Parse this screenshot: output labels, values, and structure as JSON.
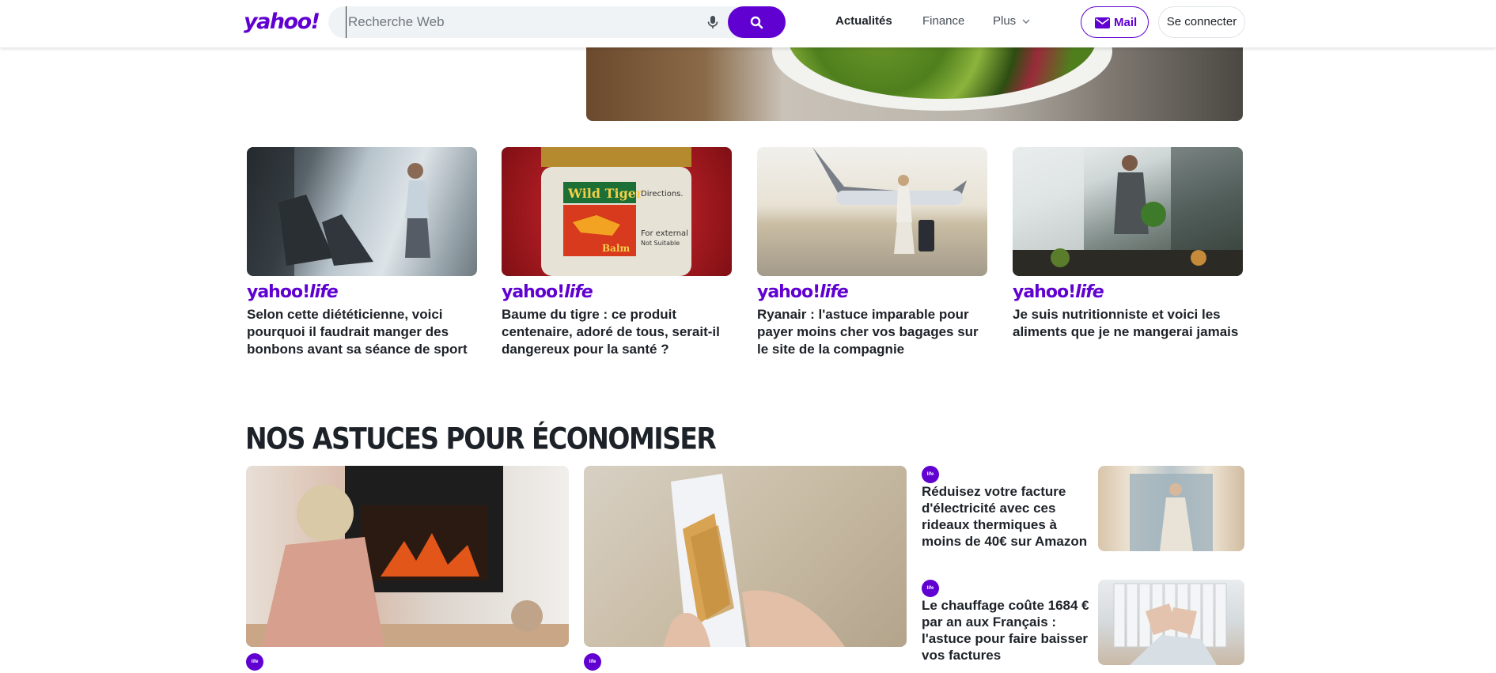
{
  "header": {
    "logo": "yahoo!",
    "search_placeholder": "Recherche Web",
    "nav": [
      "Actualités",
      "Finance",
      "Plus"
    ],
    "mail_label": "Mail",
    "signin_label": "Se connecter"
  },
  "cards": [
    {
      "brand": "yahoo!",
      "brand_suffix": "life",
      "title": "Selon cette diététicienne, voici pourquoi il faudrait manger des bonbons avant sa séance de sport"
    },
    {
      "brand": "yahoo!",
      "brand_suffix": "life",
      "title": "Baume du tigre : ce produit centenaire, adoré de tous, serait-il dangereux pour la santé ?"
    },
    {
      "brand": "yahoo!",
      "brand_suffix": "life",
      "title": "Ryanair : l'astuce imparable pour payer moins cher vos bagages sur le site de la compagnie"
    },
    {
      "brand": "yahoo!",
      "brand_suffix": "life",
      "title": "Je suis nutritionniste et voici les aliments que je ne mangerai jamais"
    }
  ],
  "balm": {
    "line1": "Wild Tiger",
    "line2": "Balm",
    "side1": "Directions.",
    "side2": "For external",
    "side3": "Not Suitable"
  },
  "section": {
    "title": "NOS ASTUCES POUR ÉCONOMISER",
    "side_items": [
      {
        "title": "Réduisez votre facture d'électricité avec ces rideaux thermiques à moins de 40€ sur Amazon"
      },
      {
        "title": "Le chauffage coûte 1684 € par an aux Français : l'astuce pour faire baisser vos factures"
      }
    ]
  },
  "colors": {
    "brand": "#6001d2",
    "text": "#1d2228",
    "search_bg": "#f0f3f5"
  }
}
